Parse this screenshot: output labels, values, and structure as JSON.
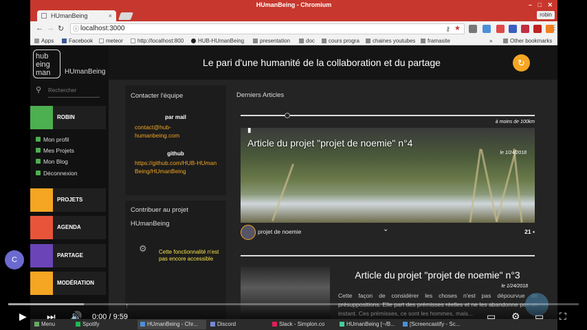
{
  "window": {
    "title": "HUmanBeing - Chromium",
    "profile": "robin",
    "tab_title": "HUmanBeing",
    "url": "localhost:3000"
  },
  "bookmarks": [
    "Apps",
    "Facebook",
    "meteor",
    "http://localhost:800",
    "HUB-HUmanBeing",
    "presentation",
    "doc",
    "cours progra",
    "chaines youtubes",
    "framasite",
    "Other bookmarks"
  ],
  "sidebar": {
    "logo_letters": "hub eing man",
    "logo_text": "HUmanBeing",
    "search_placeholder": "Rechercher",
    "user": "ROBIN",
    "sub_items": [
      "Mon profil",
      "Mes Projets",
      "Mon Blog",
      "Déconnexion"
    ],
    "nav": [
      {
        "label": "PROJETS",
        "color": "#f5a623"
      },
      {
        "label": "AGENDA",
        "color": "#e8543a"
      },
      {
        "label": "PARTAGE",
        "color": "#6b44b8"
      },
      {
        "label": "MODÉRATION",
        "color": "#f5a623"
      }
    ]
  },
  "header": {
    "title": "Le pari d'une humanité de la collaboration et du partage"
  },
  "contact": {
    "title": "Contacter l'équipe",
    "mail_label": "par mail",
    "mail_link": "contact@hub-humanbeing.com",
    "github_label": "github",
    "github_link": "https://github.com/HUB-HUmanBeing/HUmanBeing"
  },
  "contribute": {
    "title": "Contribuer au projet",
    "name": "HUmanBeing",
    "notice": "Cette fonctionnalité n'est pas encore accessible"
  },
  "articles": {
    "title": "Derniers Articles",
    "distance": "à moins de 100km",
    "slider_fraction": 0.16,
    "items": [
      {
        "title": "Article du projet \"projet de noemie\" n°4",
        "date": "le 1/24/2018",
        "author": "projet de noemie",
        "comments": "21"
      },
      {
        "title": "Article du projet \"projet de noemie\" n°3",
        "date": "le 1/24/2018",
        "text": "Cette façon de considérer les choses n'est pas dépourvue de présuppositions. Elle part des prémisses réelles et ne les abandonne pas un instant. Ces prémisses, ce sont les hommes, mais..."
      }
    ]
  },
  "video": {
    "time": "0:00 / 9:59",
    "progress": 0.0
  },
  "taskbar": [
    "Menu",
    "Spotify",
    "HUmanBeing - Chr...",
    "Discord",
    "Slack - Simplon.co",
    "HUmanBeing [~/B...",
    "[Screencastify - Sc..."
  ],
  "colors": {
    "accent": "#f5a623",
    "titlebar": "#c8372d",
    "user": "#4caf50"
  }
}
